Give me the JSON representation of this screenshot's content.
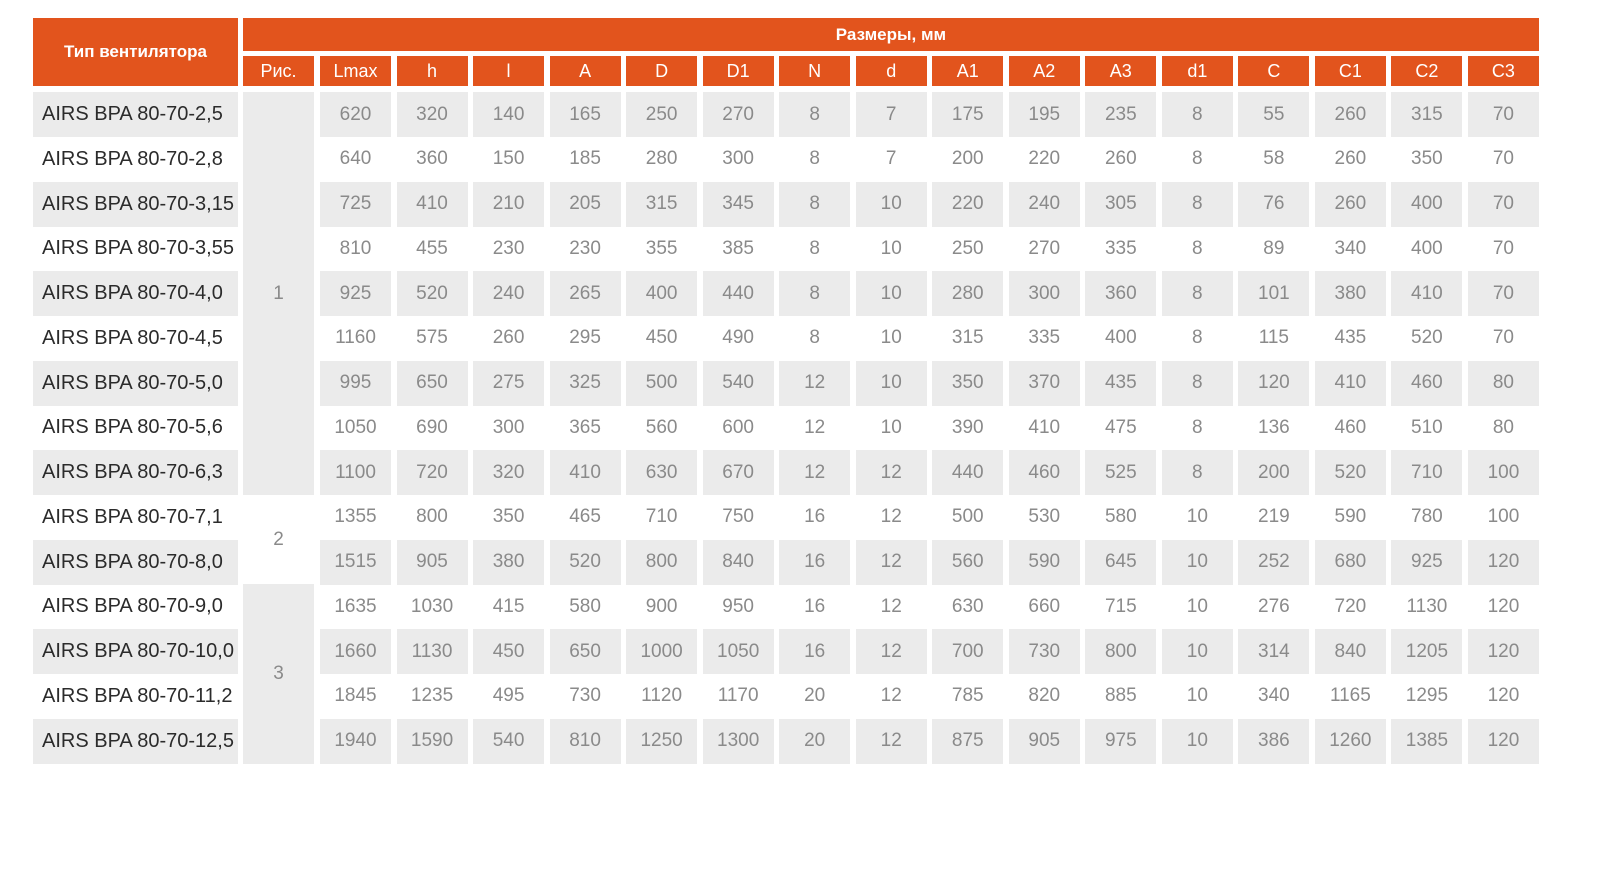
{
  "colors": {
    "header": "#e2541d",
    "stripe": "#ebebeb",
    "text_name": "#2b2b2b",
    "text_value": "#8a8a8a"
  },
  "header": {
    "type_label": "Тип вентилятора",
    "sizes_label": "Размеры, мм",
    "fig_label": "Рис.",
    "columns": [
      "Lmax",
      "h",
      "l",
      "A",
      "D",
      "D1",
      "N",
      "d",
      "A1",
      "A2",
      "A3",
      "d1",
      "C",
      "C1",
      "C2",
      "C3"
    ]
  },
  "figure_groups": [
    {
      "label": "1",
      "row_start": 0,
      "row_count": 9
    },
    {
      "label": "2",
      "row_start": 9,
      "row_count": 2
    },
    {
      "label": "3",
      "row_start": 11,
      "row_count": 4
    }
  ],
  "rows": [
    {
      "name": "AIRS BPA 80-70-2,5",
      "values": [
        "620",
        "320",
        "140",
        "165",
        "250",
        "270",
        "8",
        "7",
        "175",
        "195",
        "235",
        "8",
        "55",
        "260",
        "315",
        "70"
      ]
    },
    {
      "name": "AIRS BPA 80-70-2,8",
      "values": [
        "640",
        "360",
        "150",
        "185",
        "280",
        "300",
        "8",
        "7",
        "200",
        "220",
        "260",
        "8",
        "58",
        "260",
        "350",
        "70"
      ]
    },
    {
      "name": "AIRS BPA 80-70-3,15",
      "values": [
        "725",
        "410",
        "210",
        "205",
        "315",
        "345",
        "8",
        "10",
        "220",
        "240",
        "305",
        "8",
        "76",
        "260",
        "400",
        "70"
      ]
    },
    {
      "name": "AIRS BPA 80-70-3,55",
      "values": [
        "810",
        "455",
        "230",
        "230",
        "355",
        "385",
        "8",
        "10",
        "250",
        "270",
        "335",
        "8",
        "89",
        "340",
        "400",
        "70"
      ]
    },
    {
      "name": "AIRS BPA 80-70-4,0",
      "values": [
        "925",
        "520",
        "240",
        "265",
        "400",
        "440",
        "8",
        "10",
        "280",
        "300",
        "360",
        "8",
        "101",
        "380",
        "410",
        "70"
      ]
    },
    {
      "name": "AIRS BPA 80-70-4,5",
      "values": [
        "1160",
        "575",
        "260",
        "295",
        "450",
        "490",
        "8",
        "10",
        "315",
        "335",
        "400",
        "8",
        "115",
        "435",
        "520",
        "70"
      ]
    },
    {
      "name": "AIRS BPA 80-70-5,0",
      "values": [
        "995",
        "650",
        "275",
        "325",
        "500",
        "540",
        "12",
        "10",
        "350",
        "370",
        "435",
        "8",
        "120",
        "410",
        "460",
        "80"
      ]
    },
    {
      "name": "AIRS BPA 80-70-5,6",
      "values": [
        "1050",
        "690",
        "300",
        "365",
        "560",
        "600",
        "12",
        "10",
        "390",
        "410",
        "475",
        "8",
        "136",
        "460",
        "510",
        "80"
      ]
    },
    {
      "name": "AIRS BPA 80-70-6,3",
      "values": [
        "1100",
        "720",
        "320",
        "410",
        "630",
        "670",
        "12",
        "12",
        "440",
        "460",
        "525",
        "8",
        "200",
        "520",
        "710",
        "100"
      ]
    },
    {
      "name": "AIRS BPA 80-70-7,1",
      "values": [
        "1355",
        "800",
        "350",
        "465",
        "710",
        "750",
        "16",
        "12",
        "500",
        "530",
        "580",
        "10",
        "219",
        "590",
        "780",
        "100"
      ]
    },
    {
      "name": "AIRS BPA 80-70-8,0",
      "values": [
        "1515",
        "905",
        "380",
        "520",
        "800",
        "840",
        "16",
        "12",
        "560",
        "590",
        "645",
        "10",
        "252",
        "680",
        "925",
        "120"
      ]
    },
    {
      "name": "AIRS BPA 80-70-9,0",
      "values": [
        "1635",
        "1030",
        "415",
        "580",
        "900",
        "950",
        "16",
        "12",
        "630",
        "660",
        "715",
        "10",
        "276",
        "720",
        "1130",
        "120"
      ]
    },
    {
      "name": "AIRS BPA 80-70-10,0",
      "values": [
        "1660",
        "1130",
        "450",
        "650",
        "1000",
        "1050",
        "16",
        "12",
        "700",
        "730",
        "800",
        "10",
        "314",
        "840",
        "1205",
        "120"
      ]
    },
    {
      "name": "AIRS BPA 80-70-11,2",
      "values": [
        "1845",
        "1235",
        "495",
        "730",
        "1120",
        "1170",
        "20",
        "12",
        "785",
        "820",
        "885",
        "10",
        "340",
        "1165",
        "1295",
        "120"
      ]
    },
    {
      "name": "AIRS BPA 80-70-12,5",
      "values": [
        "1940",
        "1590",
        "540",
        "810",
        "1250",
        "1300",
        "20",
        "12",
        "875",
        "905",
        "975",
        "10",
        "386",
        "1260",
        "1385",
        "120"
      ]
    }
  ]
}
